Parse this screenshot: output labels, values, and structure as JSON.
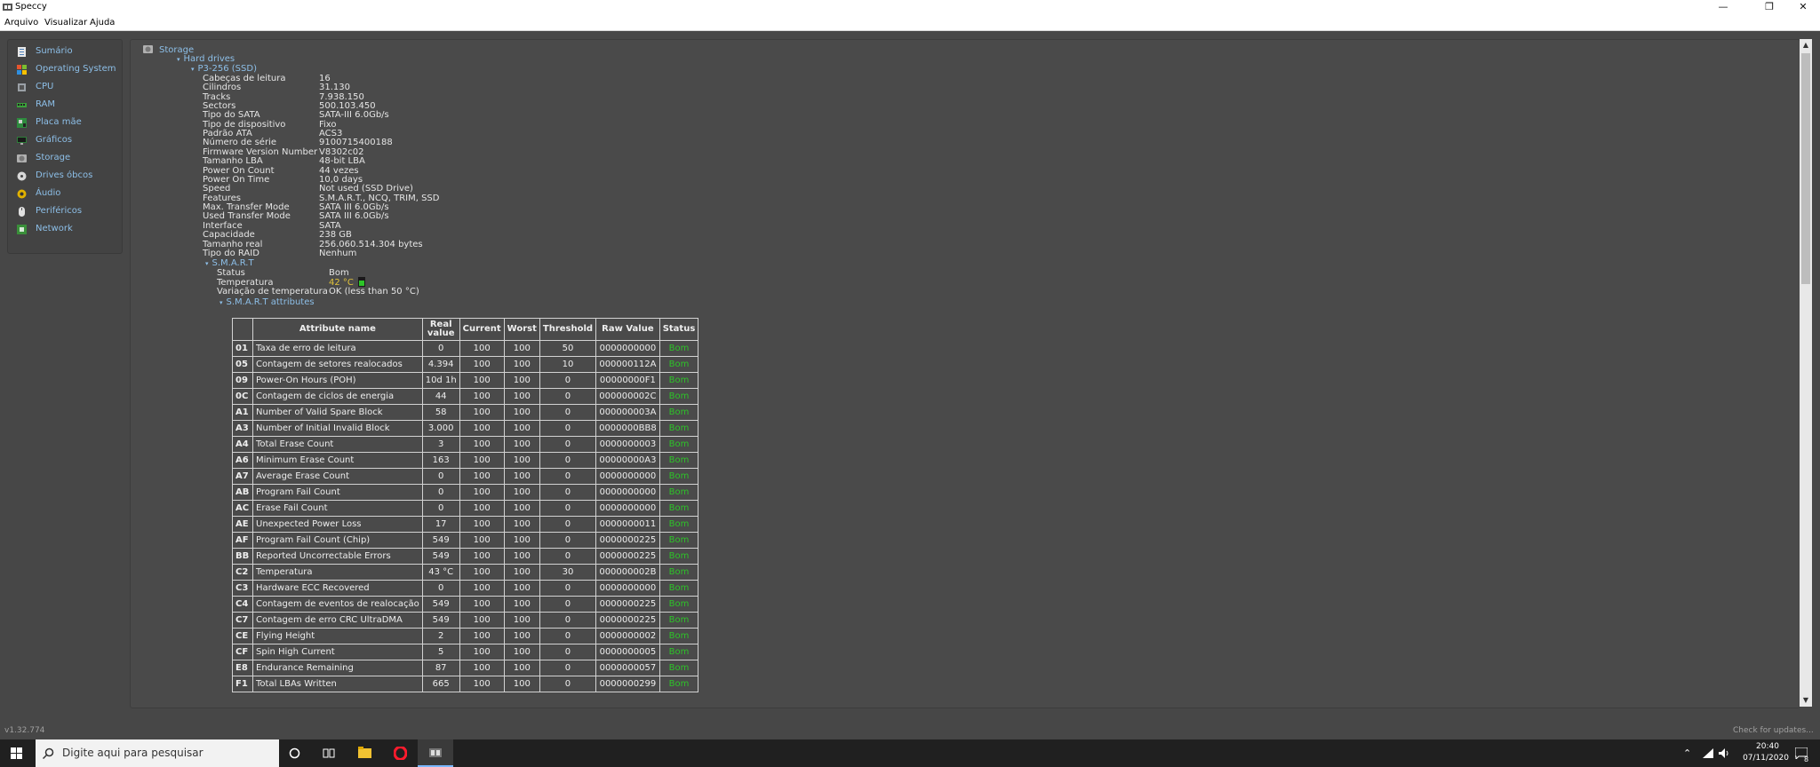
{
  "window": {
    "title": "Speccy"
  },
  "menu": [
    "Arquivo",
    "Visualizar",
    "Ajuda"
  ],
  "sidebar": {
    "items": [
      {
        "label": "Sumário",
        "icon": "summary-icon"
      },
      {
        "label": "Operating System",
        "icon": "windows-icon"
      },
      {
        "label": "CPU",
        "icon": "cpu-icon"
      },
      {
        "label": "RAM",
        "icon": "ram-icon"
      },
      {
        "label": "Placa mãe",
        "icon": "motherboard-icon"
      },
      {
        "label": "Gráficos",
        "icon": "monitor-icon"
      },
      {
        "label": "Storage",
        "icon": "storage-icon"
      },
      {
        "label": "Drives óbcos",
        "icon": "optical-drive-icon"
      },
      {
        "label": "Áudio",
        "icon": "audio-icon"
      },
      {
        "label": "Periféricos",
        "icon": "mouse-icon"
      },
      {
        "label": "Network",
        "icon": "network-icon"
      }
    ]
  },
  "content": {
    "section_title": "Storage",
    "tree": {
      "hard_drives": "Hard drives",
      "drive": "P3-256 (SSD)",
      "smart": "S.M.A.R.T",
      "smart_attrs": "S.M.A.R.T attributes"
    },
    "properties": [
      {
        "key": "Cabeças de leitura",
        "value": "16"
      },
      {
        "key": "Cilindros",
        "value": "31.130"
      },
      {
        "key": "Tracks",
        "value": "7.938.150"
      },
      {
        "key": "Sectors",
        "value": "500.103.450"
      },
      {
        "key": "Tipo do SATA",
        "value": "SATA-III 6.0Gb/s"
      },
      {
        "key": "Tipo de dispositivo",
        "value": "Fixo"
      },
      {
        "key": "Padrão ATA",
        "value": "ACS3"
      },
      {
        "key": "Número de série",
        "value": "9100715400188"
      },
      {
        "key": "Firmware Version Number",
        "value": "V8302c02"
      },
      {
        "key": "Tamanho LBA",
        "value": "48-bit LBA"
      },
      {
        "key": "Power On Count",
        "value": "44 vezes"
      },
      {
        "key": "Power On Time",
        "value": "10,0 days"
      },
      {
        "key": "Speed",
        "value": "Not used (SSD Drive)"
      },
      {
        "key": "Features",
        "value": "S.M.A.R.T., NCQ, TRIM, SSD"
      },
      {
        "key": "Max. Transfer Mode",
        "value": "SATA III 6.0Gb/s"
      },
      {
        "key": "Used Transfer Mode",
        "value": "SATA III 6.0Gb/s"
      },
      {
        "key": "Interface",
        "value": "SATA"
      },
      {
        "key": "Capacidade",
        "value": "238 GB"
      },
      {
        "key": "Tamanho real",
        "value": "256.060.514.304 bytes"
      },
      {
        "key": "Tipo do RAID",
        "value": "Nenhum"
      }
    ],
    "smart_props": {
      "status_key": "Status",
      "status_value": "Bom",
      "temp_key": "Temperatura",
      "temp_value": "42 °C",
      "temp_color": "#e0c23a",
      "tempvar_key": "Variação de temperatura",
      "tempvar_value": "OK (less than 50 °C)"
    },
    "table": {
      "headers": [
        "",
        "Attribute name",
        "Real value",
        "Current",
        "Worst",
        "Threshold",
        "Raw Value",
        "Status"
      ],
      "rows": [
        [
          "01",
          "Taxa de erro de leitura",
          "0",
          "100",
          "100",
          "50",
          "0000000000",
          "Bom"
        ],
        [
          "05",
          "Contagem de setores realocados",
          "4.394",
          "100",
          "100",
          "10",
          "000000112A",
          "Bom"
        ],
        [
          "09",
          "Power-On Hours (POH)",
          "10d 1h",
          "100",
          "100",
          "0",
          "00000000F1",
          "Bom"
        ],
        [
          "0C",
          "Contagem de ciclos de energia",
          "44",
          "100",
          "100",
          "0",
          "000000002C",
          "Bom"
        ],
        [
          "A1",
          "Number of Valid Spare Block",
          "58",
          "100",
          "100",
          "0",
          "000000003A",
          "Bom"
        ],
        [
          "A3",
          "Number of Initial Invalid Block",
          "3.000",
          "100",
          "100",
          "0",
          "0000000BB8",
          "Bom"
        ],
        [
          "A4",
          "Total Erase Count",
          "3",
          "100",
          "100",
          "0",
          "0000000003",
          "Bom"
        ],
        [
          "A6",
          "Minimum Erase Count",
          "163",
          "100",
          "100",
          "0",
          "00000000A3",
          "Bom"
        ],
        [
          "A7",
          "Average Erase Count",
          "0",
          "100",
          "100",
          "0",
          "0000000000",
          "Bom"
        ],
        [
          "AB",
          "Program Fail Count",
          "0",
          "100",
          "100",
          "0",
          "0000000000",
          "Bom"
        ],
        [
          "AC",
          "Erase Fail Count",
          "0",
          "100",
          "100",
          "0",
          "0000000000",
          "Bom"
        ],
        [
          "AE",
          "Unexpected Power Loss",
          "17",
          "100",
          "100",
          "0",
          "0000000011",
          "Bom"
        ],
        [
          "AF",
          "Program Fail Count (Chip)",
          "549",
          "100",
          "100",
          "0",
          "0000000225",
          "Bom"
        ],
        [
          "BB",
          "Reported Uncorrectable Errors",
          "549",
          "100",
          "100",
          "0",
          "0000000225",
          "Bom"
        ],
        [
          "C2",
          "Temperatura",
          "43 °C",
          "100",
          "100",
          "30",
          "000000002B",
          "Bom"
        ],
        [
          "C3",
          "Hardware ECC Recovered",
          "0",
          "100",
          "100",
          "0",
          "0000000000",
          "Bom"
        ],
        [
          "C4",
          "Contagem de eventos de realocação",
          "549",
          "100",
          "100",
          "0",
          "0000000225",
          "Bom"
        ],
        [
          "C7",
          "Contagem de erro CRC UltraDMA",
          "549",
          "100",
          "100",
          "0",
          "0000000225",
          "Bom"
        ],
        [
          "CE",
          "Flying Height",
          "2",
          "100",
          "100",
          "0",
          "0000000002",
          "Bom"
        ],
        [
          "CF",
          "Spin High Current",
          "5",
          "100",
          "100",
          "0",
          "0000000005",
          "Bom"
        ],
        [
          "E8",
          "Endurance Remaining",
          "87",
          "100",
          "100",
          "0",
          "0000000057",
          "Bom"
        ],
        [
          "F1",
          "Total LBAs Written",
          "665",
          "100",
          "100",
          "0",
          "0000000299",
          "Bom"
        ]
      ],
      "status_color": "#2dc428"
    }
  },
  "statusbar": {
    "version": "v1.32.774",
    "updates": "Check for updates..."
  },
  "taskbar": {
    "search_placeholder": "Digite aqui para pesquisar",
    "time": "20:40",
    "date": "07/11/2020",
    "notif_count": "8"
  }
}
